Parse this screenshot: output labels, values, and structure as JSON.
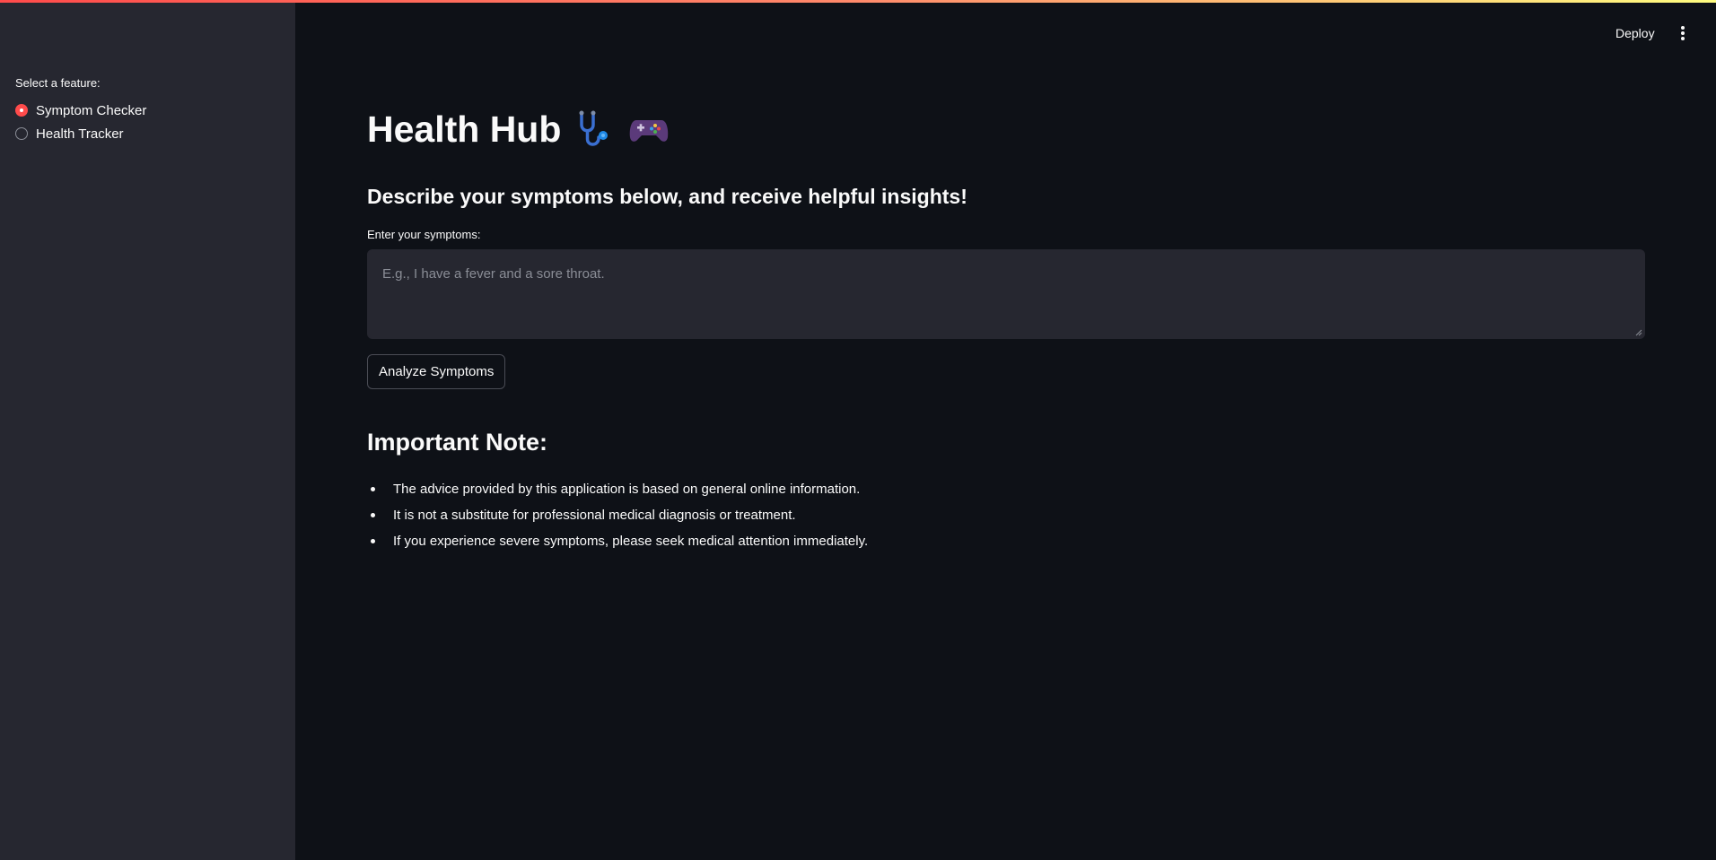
{
  "header": {
    "deploy_label": "Deploy",
    "menu_icon": "kebab-menu-icon"
  },
  "sidebar": {
    "label": "Select a feature:",
    "options": [
      {
        "label": "Symptom Checker",
        "selected": true
      },
      {
        "label": "Health Tracker",
        "selected": false
      }
    ]
  },
  "main": {
    "title": "Health Hub",
    "title_icons": [
      "stethoscope-icon",
      "game-controller-icon"
    ],
    "subtitle": "Describe your symptoms below, and receive helpful insights!",
    "symptoms_field": {
      "label": "Enter your symptoms:",
      "placeholder": "E.g., I have a fever and a sore throat.",
      "value": ""
    },
    "analyze_button": "Analyze Symptoms",
    "note": {
      "heading": "Important Note:",
      "items": [
        "The advice provided by this application is based on general online information.",
        "It is not a substitute for professional medical diagnosis or treatment.",
        "If you experience severe symptoms, please seek medical attention immediately."
      ]
    }
  },
  "colors": {
    "background": "#0e1117",
    "sidebar": "#262730",
    "accent": "#ff4b4b",
    "text": "#fafafa"
  }
}
